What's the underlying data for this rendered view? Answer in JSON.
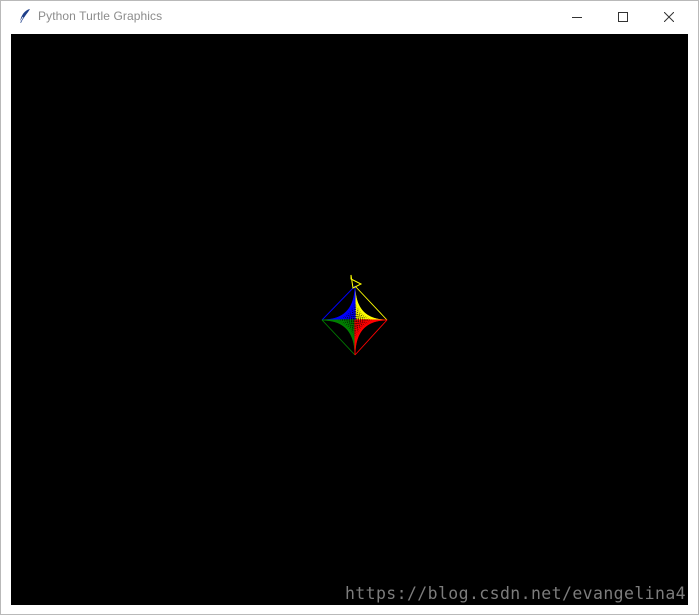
{
  "window": {
    "title": "Python Turtle Graphics",
    "buttons": {
      "minimize": "minimize-icon",
      "maximize": "maximize-icon",
      "close": "close-icon"
    },
    "icon": "feather-icon"
  },
  "canvas": {
    "background": "#000000",
    "pen_colors": [
      "#ffff00",
      "#0000ff",
      "#008000",
      "#ff0000"
    ],
    "turtle": "classic-arrow-turtle"
  },
  "watermark": {
    "text": "https://blog.csdn.net/evangelina4"
  }
}
